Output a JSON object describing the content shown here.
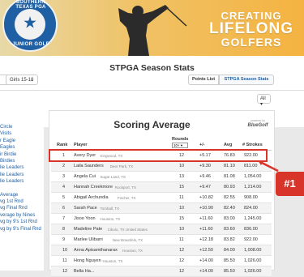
{
  "banner": {
    "logo_top": "SOUTHERN TEXAS PGA",
    "logo_bottom": "JUNIOR GOLF",
    "tagline_1": "CREATING",
    "tagline_2": "LIFELONG",
    "tagline_3": "GOLFERS"
  },
  "page_title": "STPGA Season Stats",
  "controls": {
    "division": "Girls 15-18",
    "points_list": "Points List",
    "season_stats": "STPGA Season Stats",
    "filter": "All"
  },
  "left_nav": [
    "Circle",
    "Visits",
    "r Eagle",
    "Eagles",
    "ir Birdie",
    "Birdies",
    "lie Leaders",
    "lie Leaders",
    "lie Leaders",
    "Average",
    "vg 1st Rnd",
    "vg Final Rnd",
    "verage by Nines",
    "vg by 9's 1st Rnd",
    "vg by 9's Final Rnd"
  ],
  "table": {
    "title": "Scoring Average",
    "powered_by": "powered by",
    "powered_brand": "BlueGolf",
    "headers": {
      "rank": "Rank",
      "player": "Player",
      "rounds": "Rounds",
      "rounds_filter": "10+",
      "plusminus": "+/-",
      "avg": "Avg",
      "strokes": "# Strokes"
    },
    "rows": [
      {
        "rank": "1",
        "name": "Avery Dyer",
        "loc": "Kingwood, TX",
        "rounds": "12",
        "pm": "+5.17",
        "avg": "76.83",
        "strokes": "922.00"
      },
      {
        "rank": "2",
        "name": "Laila Saunders",
        "loc": "Deer Park, TX",
        "rounds": "10",
        "pm": "+9.30",
        "avg": "81.10",
        "strokes": "811.00"
      },
      {
        "rank": "3",
        "name": "Angela Cui",
        "loc": "Sugar Land, TX",
        "rounds": "13",
        "pm": "+9.46",
        "avg": "81.08",
        "strokes": "1,054.00"
      },
      {
        "rank": "4",
        "name": "Hannah Creekmore",
        "loc": "Rockport, TX",
        "rounds": "15",
        "pm": "+9.47",
        "avg": "80.93",
        "strokes": "1,214.00"
      },
      {
        "rank": "5",
        "name": "Abigail Archundia",
        "loc": "Fischer, TX",
        "rounds": "11",
        "pm": "+10.82",
        "avg": "82.55",
        "strokes": "908.00"
      },
      {
        "rank": "6",
        "name": "Sarah Pace",
        "loc": "Tomball, TX",
        "rounds": "10",
        "pm": "+10.90",
        "avg": "82.40",
        "strokes": "824.00"
      },
      {
        "rank": "7",
        "name": "Jisoo Yoon",
        "loc": "Houston, TX",
        "rounds": "15",
        "pm": "+11.60",
        "avg": "83.00",
        "strokes": "1,245.00"
      },
      {
        "rank": "8",
        "name": "Madeline Pate",
        "loc": "Cibolo, TX United States",
        "rounds": "10",
        "pm": "+11.60",
        "avg": "83.60",
        "strokes": "836.00"
      },
      {
        "rank": "9",
        "name": "Marlee Ulibarri",
        "loc": "New Braunfels, TX",
        "rounds": "11",
        "pm": "+12.18",
        "avg": "83.82",
        "strokes": "922.00"
      },
      {
        "rank": "10",
        "name": "Anna Apisamthanarax",
        "loc": "Houston, TX",
        "rounds": "12",
        "pm": "+12.50",
        "avg": "84.00",
        "strokes": "1,008.00"
      },
      {
        "rank": "11",
        "name": "Hong Nguyen",
        "loc": "Houston, TX",
        "rounds": "12",
        "pm": "+14.00",
        "avg": "85.50",
        "strokes": "1,026.00"
      },
      {
        "rank": "12",
        "name": "Bella Ha...",
        "loc": "",
        "rounds": "12",
        "pm": "+14.00",
        "avg": "85.50",
        "strokes": "1,026.00"
      }
    ]
  },
  "annotation": {
    "badge": "#1"
  },
  "colors": {
    "accent": "#1f5fa3",
    "highlight": "#d9342a"
  }
}
